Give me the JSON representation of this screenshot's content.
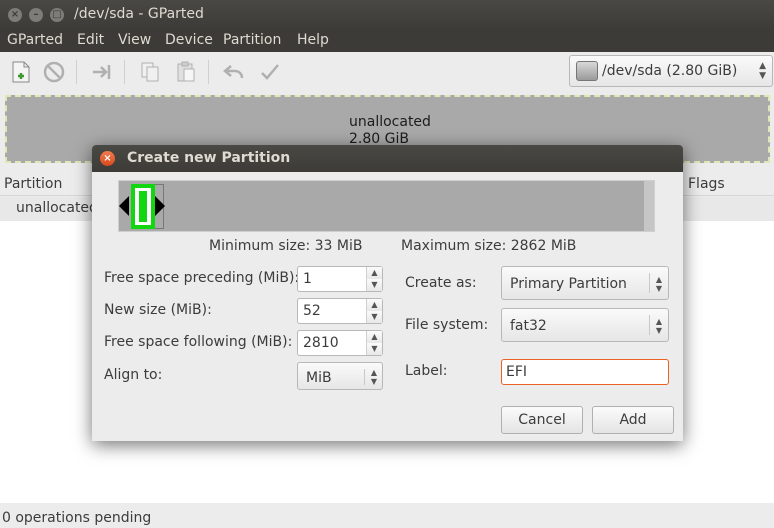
{
  "window": {
    "title": "/dev/sda - GParted"
  },
  "menubar": {
    "items": [
      "GParted",
      "Edit",
      "View",
      "Device",
      "Partition",
      "Help"
    ]
  },
  "toolbar": {
    "icons": [
      "new-icon",
      "delete-icon",
      "resize-move-icon",
      "copy-icon",
      "paste-icon",
      "undo-icon",
      "apply-icon"
    ],
    "device": {
      "label": "/dev/sda  (2.80 GiB)"
    }
  },
  "disk": {
    "name": "unallocated",
    "size": "2.80 GiB"
  },
  "partition_list": {
    "columns": [
      "Partition",
      "Flags"
    ],
    "rows": [
      {
        "partition": "unallocated"
      }
    ]
  },
  "dialog": {
    "title": "Create new Partition",
    "min_size": "Minimum size: 33 MiB",
    "max_size": "Maximum size: 2862 MiB",
    "labels": {
      "free_preceding": "Free space preceding (MiB):",
      "new_size": "New size (MiB):",
      "free_following": "Free space following (MiB):",
      "align_to": "Align to:",
      "create_as": "Create as:",
      "file_system": "File system:",
      "label": "Label:"
    },
    "values": {
      "free_preceding": "1",
      "new_size": "52",
      "free_following": "2810",
      "align_to": "MiB",
      "create_as": "Primary Partition",
      "file_system": "fat32",
      "label": "EFI"
    },
    "buttons": {
      "cancel": "Cancel",
      "add": "Add"
    }
  },
  "status": {
    "text": "0 operations pending"
  },
  "colors": {
    "partition_accent": "#11d610",
    "focus_border": "#e96125",
    "unallocated": "#a9a9a9"
  }
}
